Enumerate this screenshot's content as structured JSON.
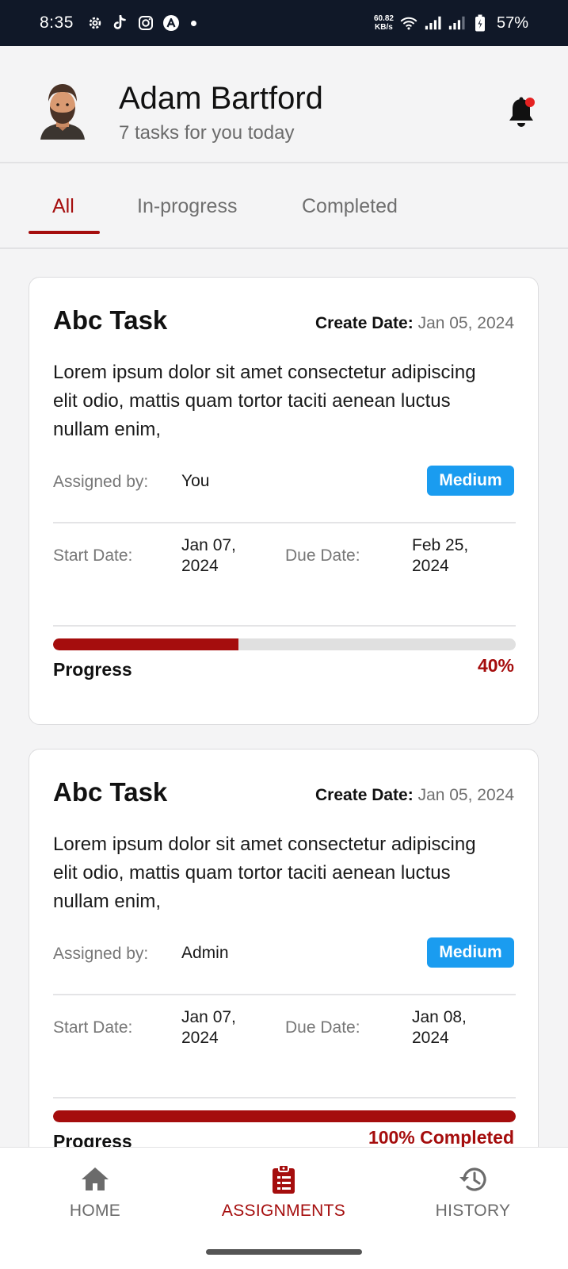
{
  "status_bar": {
    "time": "8:35",
    "net_speed_value": "60.82",
    "net_speed_unit": "KB/s",
    "battery": "57%",
    "left_icons": [
      "settings-icon",
      "tiktok-icon",
      "instagram-icon",
      "app-icon"
    ]
  },
  "header": {
    "name": "Adam Bartford",
    "subtitle": "7 tasks for you today",
    "notification_dot_color": "#e52222"
  },
  "tabs": [
    {
      "label": "All",
      "active": true
    },
    {
      "label": "In-progress",
      "active": false
    },
    {
      "label": "Completed",
      "active": false
    }
  ],
  "labels": {
    "create_date": "Create Date:",
    "assigned_by": "Assigned by:",
    "start_date": "Start Date:",
    "due_date": "Due Date:",
    "progress": "Progress"
  },
  "tasks": [
    {
      "title": "Abc Task",
      "create_date": "Jan 05, 2024",
      "description": "Lorem ipsum dolor sit amet consectetur adipiscing elit odio, mattis quam tortor taciti aenean luctus nullam enim,",
      "assigned_by": "You",
      "priority": "Medium",
      "start_date_line1": "Jan 07,",
      "start_date_line2": "2024",
      "due_date_line1": "Feb 25,",
      "due_date_line2": "2024",
      "progress_percent": 40,
      "progress_text": "40%"
    },
    {
      "title": "Abc Task",
      "create_date": "Jan 05, 2024",
      "description": "Lorem ipsum dolor sit amet consectetur adipiscing elit odio, mattis quam tortor taciti aenean luctus nullam enim,",
      "assigned_by": "Admin",
      "priority": "Medium",
      "start_date_line1": "Jan 07,",
      "start_date_line2": "2024",
      "due_date_line1": "Jan 08,",
      "due_date_line2": "2024",
      "progress_percent": 100,
      "progress_text": "100% Completed"
    }
  ],
  "bottom_nav": [
    {
      "label": "HOME",
      "icon": "home-icon",
      "active": false
    },
    {
      "label": "ASSIGNMENTS",
      "icon": "clipboard-icon",
      "active": true
    },
    {
      "label": "HISTORY",
      "icon": "history-icon",
      "active": false
    }
  ],
  "colors": {
    "accent": "#a50d0d",
    "badge_blue": "#1a9cf0",
    "status_bar_bg": "#101828"
  }
}
